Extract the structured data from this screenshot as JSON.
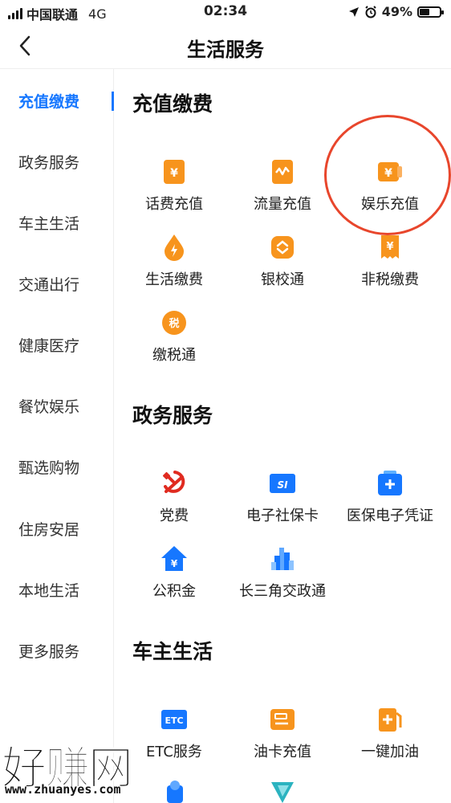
{
  "status_bar": {
    "carrier": "中国联通",
    "network": "4G",
    "time": "02:34",
    "battery": "49%"
  },
  "nav": {
    "title": "生活服务"
  },
  "sidebar": {
    "items": [
      {
        "label": "充值缴费",
        "active": true
      },
      {
        "label": "政务服务"
      },
      {
        "label": "车主生活"
      },
      {
        "label": "交通出行"
      },
      {
        "label": "健康医疗"
      },
      {
        "label": "餐饮娱乐"
      },
      {
        "label": "甄选购物"
      },
      {
        "label": "住房安居"
      },
      {
        "label": "本地生活"
      },
      {
        "label": "更多服务"
      }
    ]
  },
  "sections": [
    {
      "title": "充值缴费",
      "items": [
        {
          "label": "话费充值",
          "icon": "phone-bill-icon"
        },
        {
          "label": "流量充值",
          "icon": "data-recharge-icon"
        },
        {
          "label": "娱乐充值",
          "icon": "entertainment-recharge-icon"
        },
        {
          "label": "生活缴费",
          "icon": "utility-payment-icon"
        },
        {
          "label": "银校通",
          "icon": "bank-school-icon"
        },
        {
          "label": "非税缴费",
          "icon": "non-tax-payment-icon"
        },
        {
          "label": "缴税通",
          "icon": "tax-payment-icon"
        }
      ]
    },
    {
      "title": "政务服务",
      "items": [
        {
          "label": "党费",
          "icon": "party-fee-icon"
        },
        {
          "label": "电子社保卡",
          "icon": "social-security-card-icon"
        },
        {
          "label": "医保电子凭证",
          "icon": "medical-insurance-icon"
        },
        {
          "label": "公积金",
          "icon": "housing-fund-icon"
        },
        {
          "label": "长三角交政通",
          "icon": "yangtze-delta-icon"
        }
      ]
    },
    {
      "title": "车主生活",
      "items": [
        {
          "label": "ETC服务",
          "icon": "etc-icon"
        },
        {
          "label": "油卡充值",
          "icon": "fuel-card-icon"
        },
        {
          "label": "一键加油",
          "icon": "refuel-icon"
        }
      ]
    }
  ],
  "icon_glyphs": {
    "yen": "¥",
    "tax": "税",
    "si": "SI",
    "etc": "ETC",
    "plus": "+"
  },
  "watermark": {
    "text": "好赚网",
    "url": "www.zhuanyes.com"
  },
  "colors": {
    "accent": "#1677ff",
    "orange": "#f7941d",
    "red": "#e02b20",
    "circle": "#e8462c"
  }
}
